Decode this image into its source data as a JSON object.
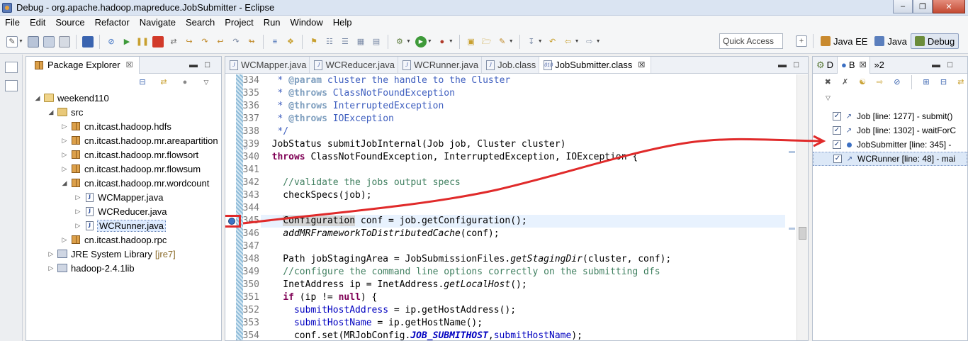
{
  "window": {
    "title": "Debug - org.apache.hadoop.mapreduce.JobSubmitter - Eclipse",
    "minimize": "‒",
    "restore": "❐",
    "close": "✕"
  },
  "menu": [
    "File",
    "Edit",
    "Source",
    "Refactor",
    "Navigate",
    "Search",
    "Project",
    "Run",
    "Window",
    "Help"
  ],
  "toolbar": {
    "quick_access_placeholder": "Quick Access",
    "perspectives": [
      {
        "label": "Java EE",
        "color": "#c98a2f",
        "active": false
      },
      {
        "label": "Java",
        "color": "#5b7fbd",
        "active": false
      },
      {
        "label": "Debug",
        "color": "#6b8c3a",
        "active": true
      }
    ]
  },
  "package_explorer": {
    "tab_label": "Package Explorer",
    "close_glyph": "☒",
    "tree": [
      {
        "indent": 0,
        "twisty": "◢",
        "icon": "project",
        "label": "weekend110",
        "decoration": ""
      },
      {
        "indent": 1,
        "twisty": "◢",
        "icon": "source-folder",
        "label": "src",
        "decoration": ""
      },
      {
        "indent": 2,
        "twisty": "▷",
        "icon": "package",
        "label": "cn.itcast.hadoop.hdfs",
        "decoration": ""
      },
      {
        "indent": 2,
        "twisty": "▷",
        "icon": "package",
        "label": "cn.itcast.hadoop.mr.areapartition",
        "decoration": ""
      },
      {
        "indent": 2,
        "twisty": "▷",
        "icon": "package",
        "label": "cn.itcast.hadoop.mr.flowsort",
        "decoration": ""
      },
      {
        "indent": 2,
        "twisty": "▷",
        "icon": "package",
        "label": "cn.itcast.hadoop.mr.flowsum",
        "decoration": ""
      },
      {
        "indent": 2,
        "twisty": "◢",
        "icon": "package",
        "label": "cn.itcast.hadoop.mr.wordcount",
        "decoration": ""
      },
      {
        "indent": 3,
        "twisty": "▷",
        "icon": "java",
        "label": "WCMapper.java",
        "decoration": ""
      },
      {
        "indent": 3,
        "twisty": "▷",
        "icon": "java",
        "label": "WCReducer.java",
        "decoration": ""
      },
      {
        "indent": 3,
        "twisty": "▷",
        "icon": "java",
        "label": "WCRunner.java",
        "decoration": "",
        "selected": true
      },
      {
        "indent": 2,
        "twisty": "▷",
        "icon": "package",
        "label": "cn.itcast.hadoop.rpc",
        "decoration": ""
      },
      {
        "indent": 1,
        "twisty": "▷",
        "icon": "library",
        "label": "JRE System Library",
        "decoration": "[jre7]"
      },
      {
        "indent": 1,
        "twisty": "▷",
        "icon": "library",
        "label": "hadoop-2.4.1lib",
        "decoration": ""
      }
    ]
  },
  "editor": {
    "tabs": [
      {
        "label": "WCMapper.java",
        "icon": "J",
        "active": false
      },
      {
        "label": "WCReducer.java",
        "icon": "J",
        "active": false
      },
      {
        "label": "WCRunner.java",
        "icon": "J",
        "active": false
      },
      {
        "label": "Job.class",
        "icon": "J",
        "active": false
      },
      {
        "label": "JobSubmitter.class",
        "icon": "010",
        "active": true
      }
    ],
    "close_glyph": "☒",
    "lines": [
      {
        "n": "334",
        "segs": [
          [
            "doc",
            "   * "
          ],
          [
            "tag",
            "@param"
          ],
          [
            "doc",
            " cluster the handle to the Cluster"
          ]
        ]
      },
      {
        "n": "335",
        "segs": [
          [
            "doc",
            "   * "
          ],
          [
            "tag",
            "@throws"
          ],
          [
            "doc",
            " ClassNotFoundException"
          ]
        ]
      },
      {
        "n": "336",
        "segs": [
          [
            "doc",
            "   * "
          ],
          [
            "tag",
            "@throws"
          ],
          [
            "doc",
            " InterruptedException"
          ]
        ]
      },
      {
        "n": "337",
        "segs": [
          [
            "doc",
            "   * "
          ],
          [
            "tag",
            "@throws"
          ],
          [
            "doc",
            " IOException"
          ]
        ]
      },
      {
        "n": "338",
        "segs": [
          [
            "doc",
            "   */"
          ]
        ]
      },
      {
        "n": "339",
        "fold": true,
        "segs": [
          [
            "",
            "  JobStatus submitJobInternal(Job job, Cluster cluster)"
          ]
        ]
      },
      {
        "n": "340",
        "segs": [
          [
            "",
            "  "
          ],
          [
            "kw",
            "throws"
          ],
          [
            "",
            " ClassNotFoundException, InterruptedException, IOException {"
          ]
        ]
      },
      {
        "n": "341",
        "segs": [
          [
            "",
            ""
          ]
        ]
      },
      {
        "n": "342",
        "segs": [
          [
            "cmt",
            "    //validate the jobs output specs"
          ]
        ]
      },
      {
        "n": "343",
        "segs": [
          [
            "",
            "    checkSpecs(job);"
          ]
        ]
      },
      {
        "n": "344",
        "segs": [
          [
            "",
            ""
          ]
        ]
      },
      {
        "n": "345",
        "hl": true,
        "bp": true,
        "segs": [
          [
            "",
            "    "
          ],
          [
            "selword",
            "Configuration"
          ],
          [
            "",
            " conf = job.getConfiguration();"
          ]
        ]
      },
      {
        "n": "346",
        "segs": [
          [
            "",
            "    "
          ],
          [
            "ital",
            "addMRFrameworkToDistributedCache"
          ],
          [
            "",
            "(conf);"
          ]
        ]
      },
      {
        "n": "347",
        "segs": [
          [
            "",
            ""
          ]
        ]
      },
      {
        "n": "348",
        "segs": [
          [
            "",
            "    Path jobStagingArea = JobSubmissionFiles."
          ],
          [
            "ital",
            "getStagingDir"
          ],
          [
            "",
            "(cluster, conf);"
          ]
        ]
      },
      {
        "n": "349",
        "segs": [
          [
            "cmt",
            "    //configure the command line options correctly on the submitting dfs"
          ]
        ]
      },
      {
        "n": "350",
        "segs": [
          [
            "",
            "    InetAddress ip = InetAddress."
          ],
          [
            "ital",
            "getLocalHost"
          ],
          [
            "",
            "();"
          ]
        ]
      },
      {
        "n": "351",
        "segs": [
          [
            "",
            "    "
          ],
          [
            "kw",
            "if"
          ],
          [
            "",
            " (ip != "
          ],
          [
            "kw",
            "null"
          ],
          [
            "",
            ") {"
          ]
        ]
      },
      {
        "n": "352",
        "segs": [
          [
            "",
            "      "
          ],
          [
            "fld",
            "submitHostAddress"
          ],
          [
            "",
            " = ip.getHostAddress();"
          ]
        ]
      },
      {
        "n": "353",
        "segs": [
          [
            "",
            "      "
          ],
          [
            "fld",
            "submitHostName"
          ],
          [
            "",
            " = ip.getHostName();"
          ]
        ]
      },
      {
        "n": "354",
        "segs": [
          [
            "",
            "      conf.set(MRJobConfig."
          ],
          [
            "sfld",
            "JOB_SUBMITHOST"
          ],
          [
            "",
            ","
          ],
          [
            "fld",
            "submitHostName"
          ],
          [
            "",
            ");"
          ]
        ]
      }
    ]
  },
  "breakpoints_view": {
    "tabs": [
      {
        "label": "D",
        "icon": "gear",
        "active": false
      },
      {
        "label": "B",
        "icon": "dot",
        "active": true
      },
      {
        "label": "»2",
        "icon": "",
        "active": false
      }
    ],
    "close_glyph": "☒",
    "items": [
      {
        "label": "Job [line: 1277] - submit()",
        "checked": true,
        "icon": "method",
        "selected": false
      },
      {
        "label": "Job [line: 1302] - waitForC",
        "checked": true,
        "icon": "method",
        "selected": false
      },
      {
        "label": "JobSubmitter [line: 345] -",
        "checked": true,
        "icon": "dot",
        "selected": false
      },
      {
        "label": "WCRunner [line: 48] - mai",
        "checked": true,
        "icon": "method",
        "selected": true
      }
    ],
    "check_glyph": "✓"
  },
  "colors": {
    "annotation_red": "#e02a2a",
    "keyword": "#7f0055",
    "comment": "#3f7f5f",
    "javadoc": "#3f5fbf"
  }
}
